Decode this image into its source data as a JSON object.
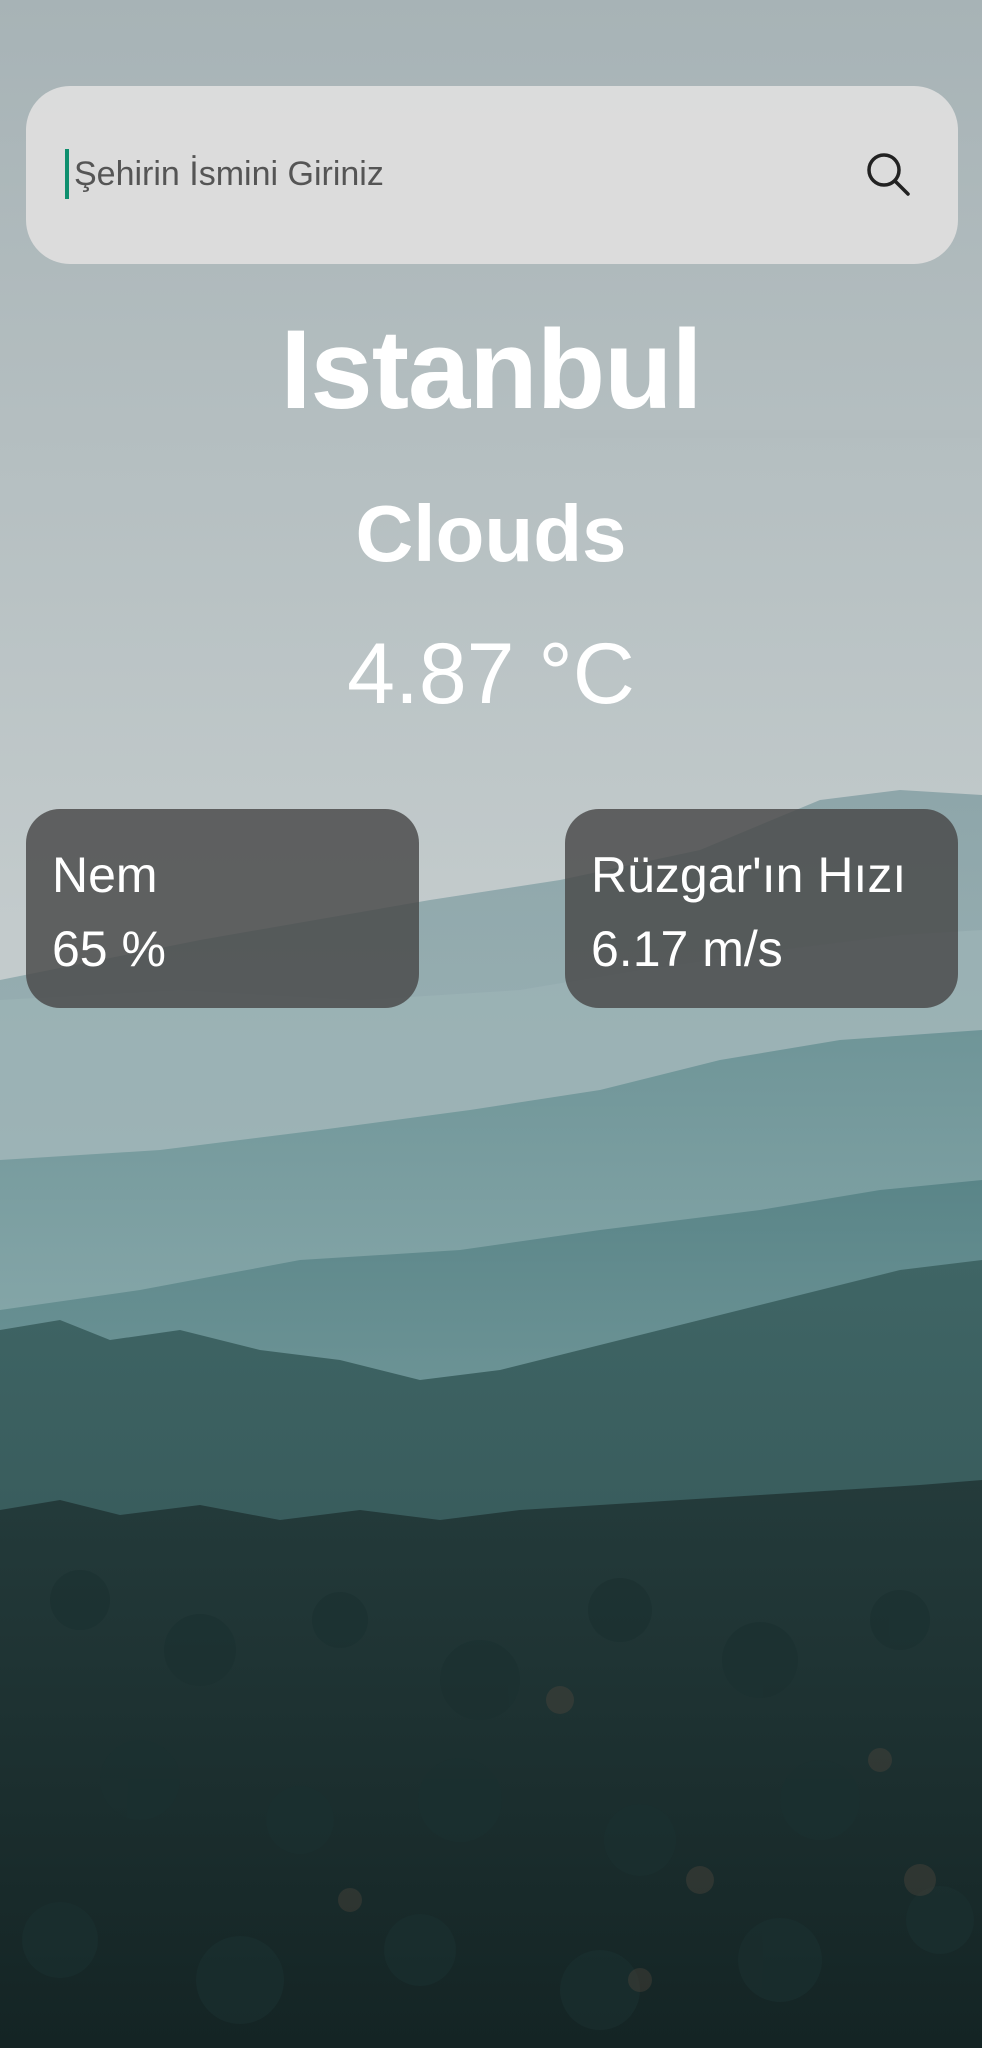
{
  "search": {
    "placeholder": "Şehirin İsmini Giriniz",
    "value": ""
  },
  "weather": {
    "city": "Istanbul",
    "condition": "Clouds",
    "temperature": "4.87 °C"
  },
  "humidity": {
    "label": "Nem",
    "value": "65 %"
  },
  "wind": {
    "label": "Rüzgar'ın Hızı",
    "value": "6.17 m/s"
  },
  "icons": {
    "search": "search-icon"
  },
  "colors": {
    "caret": "#0e8f6e",
    "card_background": "#484848",
    "search_background": "#dddddd",
    "text": "#ffffff"
  }
}
